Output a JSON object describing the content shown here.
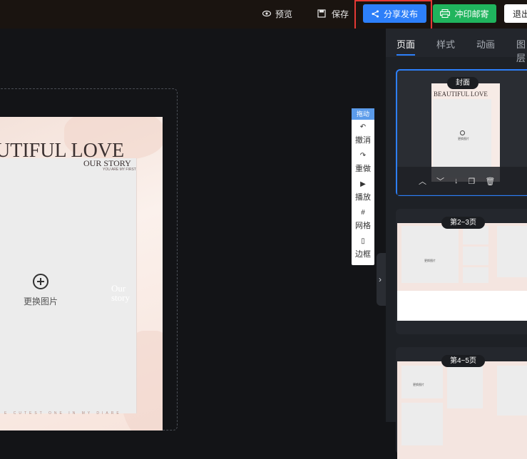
{
  "topbar": {
    "preview_label": "预览",
    "save_label": "保存",
    "share_label": "分享发布",
    "print_label": "冲印邮寄",
    "exit_label": "退出"
  },
  "canvas": {
    "big_title": "UTIFUL LOVE",
    "sub_title": "OUR STORY",
    "sub_small": "YOU ARE MY FIRST",
    "replace_label": "更换图片",
    "side_text_line1": "Our",
    "side_text_line2": "story",
    "footer_text": "E CUTEST ONE IN MY DIARE"
  },
  "toolbox": {
    "drag_label": "拖动",
    "undo_label": "撤消",
    "redo_label": "重做",
    "play_label": "播放",
    "grid_label": "网格",
    "border_label": "边框"
  },
  "sidebar": {
    "tabs": [
      "页面",
      "样式",
      "动画",
      "图层"
    ],
    "active_tab": "页面",
    "thumbs": [
      {
        "label": "封面",
        "title": "BEAUTIFUL LOVE",
        "replace_label": "更换图片"
      },
      {
        "label": "第2~3页",
        "replace_label": "更换图片"
      },
      {
        "label": "第4~5页",
        "replace_label": "更换图片"
      }
    ]
  },
  "colors": {
    "accent": "#2d7ff9",
    "print_green": "#20b45d",
    "highlight_red": "#e53935",
    "sidebar_bg": "#1e2126"
  }
}
